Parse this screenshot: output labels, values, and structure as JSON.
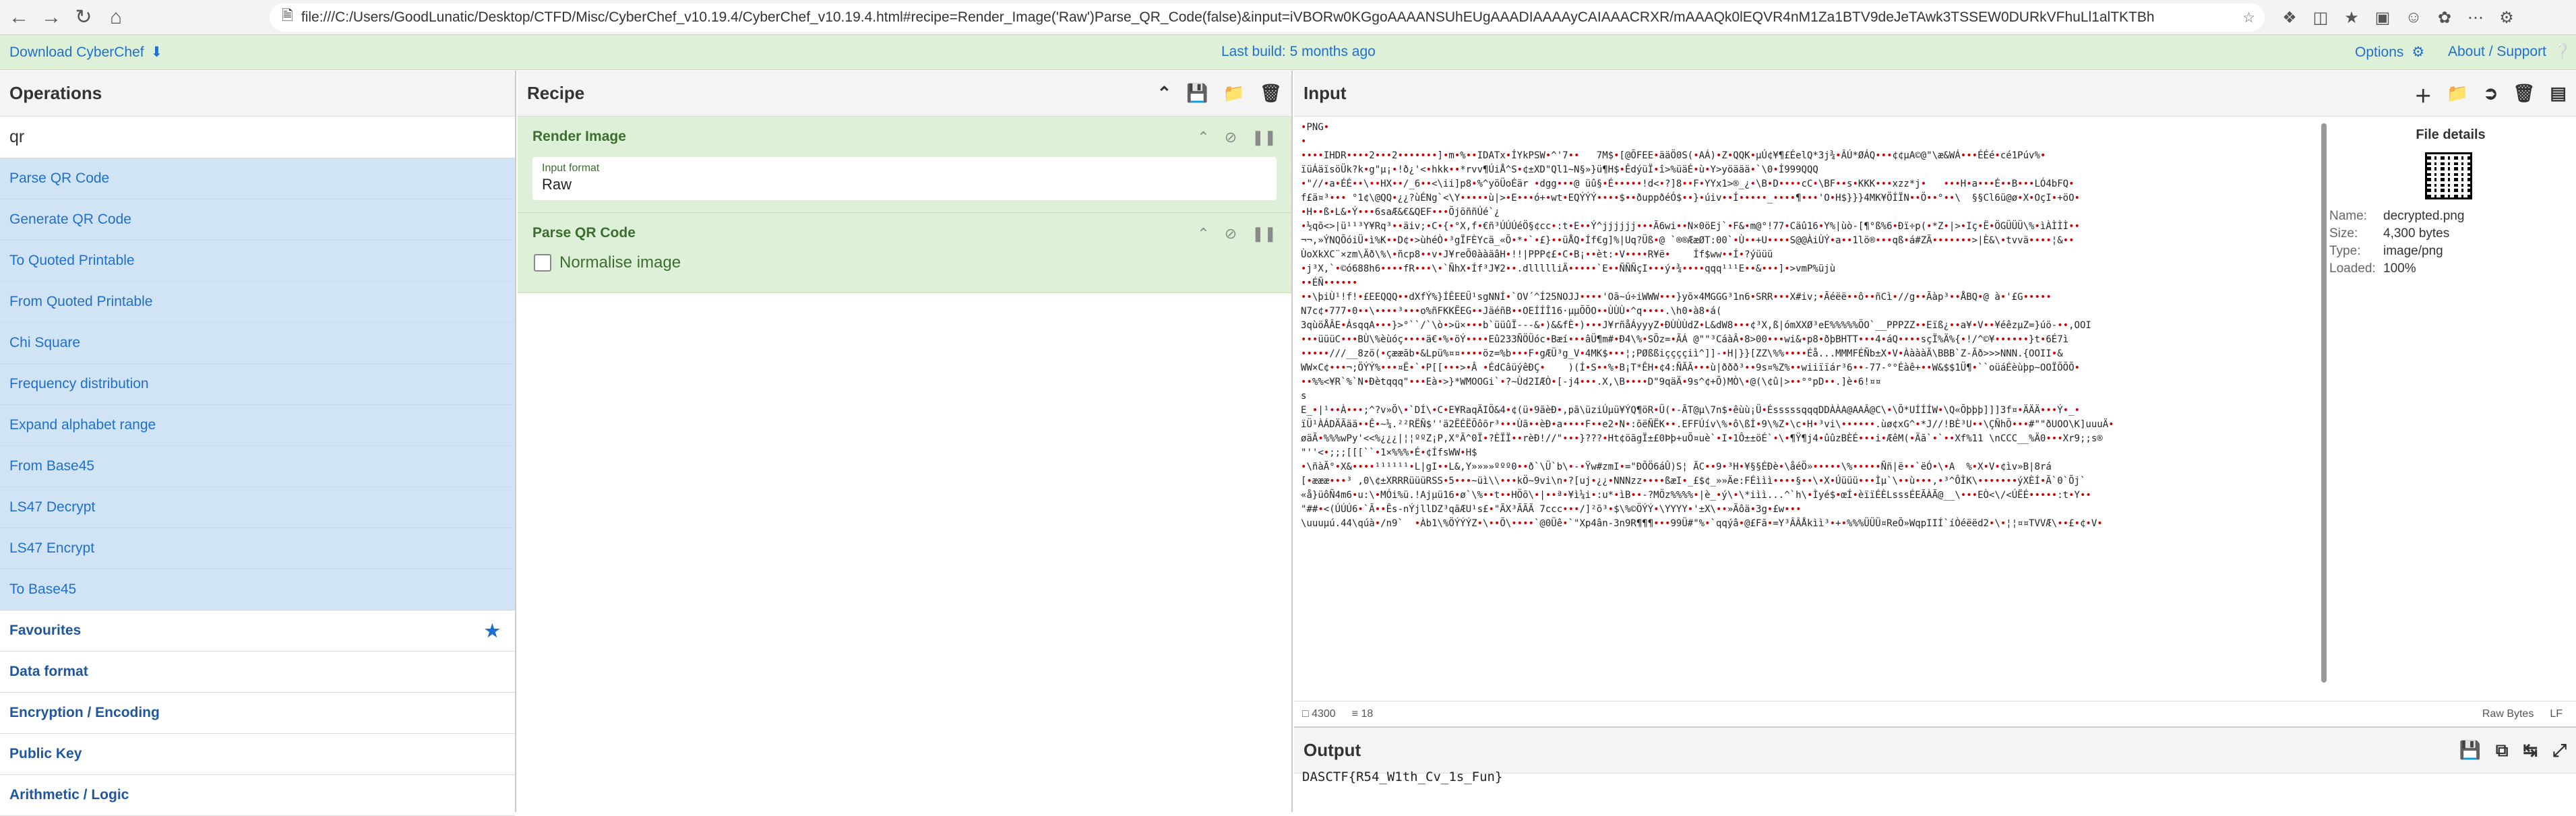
{
  "browser": {
    "url_prefix": "file:///",
    "url": "C:/Users/GoodLunatic/Desktop/CTFD/Misc/CyberChef_v10.19.4/CyberChef_v10.19.4.html#recipe=Render_Image('Raw')Parse_QR_Code(false)&input=iVBORw0KGgoAAAANSUhEUgAAADIAAAAyCAIAAACRXR/mAAAQk0lEQVR4nM1Za1BTV9deJeTAwk3TSSEW0DURkVFhuLl1alTKTBh"
  },
  "banner": {
    "download_label": "Download CyberChef",
    "build_label": "Last build: 5 months ago",
    "options_label": "Options",
    "about_label": "About / Support"
  },
  "operations": {
    "title": "Operations",
    "search_value": "qr",
    "results": [
      "Parse QR Code",
      "Generate QR Code",
      "To Quoted Printable",
      "From Quoted Printable",
      "Chi Square",
      "Frequency distribution",
      "Expand alphabet range",
      "From Base45",
      "LS47 Decrypt",
      "LS47 Encrypt",
      "To Base45"
    ],
    "categories": [
      "Favourites",
      "Data format",
      "Encryption / Encoding",
      "Public Key",
      "Arithmetic / Logic"
    ]
  },
  "recipe": {
    "title": "Recipe",
    "ops": [
      {
        "name": "Render Image",
        "field_label": "Input format",
        "field_value": "Raw"
      },
      {
        "name": "Parse QR Code",
        "checkbox_label": "Normalise image"
      }
    ]
  },
  "input": {
    "title": "Input",
    "status_chars": "4300",
    "status_lines": "18",
    "raw_bytes_label": "Raw Bytes",
    "eol_label": "LF",
    "raw_lines": [
      "•PNG•",
      "•",
      "••••IHDR••••2•••2•••••••]•m•%••IDATx•ÍYkPSW•^'7••   7M$•[@ÕFEE•ääÖ0S(•AÁ)•Z•QQK•µÚ¢¥¶£ÉelQ*3j¾•ÂÚ*ØÁQ•••¢¢µA©@\"\\æ&WÁ•••ÉÉé•cé1Púv%•",
      "ïüÁäïsöÜk?k•g\"µ¡•!ð¿'<•hkk••*rvv¶ÚiÅ^S•¢±XD\"Ql1~N§»}ü¶H$•ÊdýüÏ•î>%üäÉ•ù•Y>yöäää•`\\0•Í999QQQ",
      "•\"//•a•ÉÉ••\\••HX••/_6••<\\ii]p8•%^yöÜoÉär •dgg•••@ üû§•É•••••!d<•?]8••F•YYx1>®_¿•\\B•D••••cC•\\BF••s•KKK•••xzz*j•   •••H•a•••É••B•••LÓ4bFQ•",
      "f£ä¤³••• °1¢\\@QQ•¿¿?ùÉNg`<\\Y•••••ù|>•E•••ó+•wt•EQÝÝÝ••••$••ðuppðéÓ$••}•úiv••Í•••••_••••¶•••'O•H$}}}4MK¥ÖÍÏN••Ö••°••\\  §§Cl6ü@ø•X•OçI•+öO•",
      "•H••ß•L&•Ý•••6saÆ&€&QEF•••ÕjõññÚé`¿",
      "•½qõ<>|ü¹¹³Y¥Rq³••äiv;•C•{•°X,f•€ñ³ÚÚÚéÖ§¢cc•:t•E••Ý^jjjjjj•••Ã6wi••N×0öEj`•F&•m@°!77•Cäû16•Y%|ùò-[¶°ß%6•Ðï÷p(•*Z•|>•Iç•Ë•ÖGÜÜÜ\\%•ìÀÌÌÌ••",
      "¬¬,»ÝNQÕóiÜ•ì%K••D¢•>ùhéÒ•³gÏFÈYcä_«Õ•*•`•£}••üÅQ•Íf€g]%|Uq?Üß•@ `®®ÆæØT:00`•Ù••+U••••S@@ÀiÙÝ•a••1lö®•••qß•á#ZÃ•••••••>|È&\\•tvvä••••¦&••",
      "ÙoXkXC¨×zm\\Äð\\%\\•ñcp8••v•J¥reÕ0ààäâH•!!|PPP¢£•C•B¡••èt:•V••••R¥ë•    Íf$ww••Í•?ýüüü",
      "•j³X,`•©ó688h6••••fR•••\\•`ÑhX•Íf³J¥2••.dllllliÄ•••••`E••ÑÑÑçI•••ý•¾••••qqq¹¹¹E••&•••]•>vmP%üjù",
      "••ÉÑ••••••",
      "••\\þiÙ¹!f!•£EEQQQ••dXfÝ%}ÍÊEEÜ¹sgNNÍ•`OV´^Í25NOJJ••••'Oã~ú÷iWWW•••}yõ×4MGGG³1n6•SRR•••X#iv;•Ãéëë••ô••ñCì•//g••Ãàp³••ÅBQ•@ à•'£G•••••",
      "N7c¢•777•0••\\••••³•••o%ñFKKËEG••JäéñB••OEÍÍÎ16·µµÕÕO••ÙÙÙ•^q••••.\\h0•à8•á(",
      "3qùöÅÂE•ÁsqqA•••}>°``/`\\ò•>ü×•••b`üüûÏ---&•)&&fÈ•)•••J¥rñåÁyyyZ•ÐÙÙÙdZ•L&dW8•••¢³X,ß|ómXXØ³eE%%%%%ÖO`__PPPZZ••Eïß¿••a¥•V••¥éêzµZ=}úö-••,OOI",
      "•••üüüC•••BÙ\\%èùóç••••ä€•%•öÝ••••Eû233ÑÖÜóc•Bæí•••âÜ¶m#•Ð4\\%•SÕz=•ÃÁ @\"\"³CáàÂ•8>00•••wi&•p8•ðþBHTT•••4•áQ••••sçÏ%Ä%{•!/^©¥••••••}t•6É7ì",
      "•••••///__8zö(•çææãb•&Lpü%¤¤••••öz=%b•••F•gÆÜ³g_V•4MK$•••¦;PØßßiççççiì^]]-•H|}}[ZZ\\%%••••Éå...MMMFÉÑb±X•V•ÀàààÄ\\BBB`Z-Ãð>>>NNN.{OOII•&   ",
      "WW×C¢•••¬;ÖÝÝ%•••¤Ë•`•P[[•••>•Â •ÉdCâüýêÐÇ•    )(Í•S••%•B¡T*ÊH•¢4:ÑÃÃ•••ù|ððð³••9s¤%Z%••wiiïïár³6••-77-°°Éàê+••W&$$1Ü¶•``oüáÉèùþp~OOÏÕÕÕ•",
      "••%%<¥R`%`N•Ðètqqq\"•••Eà•>}*WMOOGi`•?~Ùd2IÆÒ•[-j4•••.X,\\B••••D\"9qäÄ•9s^¢+Õ)MÒ\\•@(\\¢û|>••°°pD••.]è•6!¤¤",
      "s",
      "E_•|¹••À•••;^?v»Õ\\•`DÍ\\•C•E¥RaqÄIÖ&4•¢(ü•9ãèÐ•,pã\\üziÚµü¥ÝQ¶öR•Ü(•-ÃT@µ\\7n$•êùù¡Ü•ÉsssssqqqDDÀÀA@AAÂ@C\\•\\Õ*UÍÍÍW•\\Q«Õþþþ]]]3f¤•ÄÄÄ•••Ý•_•",
      "ïÜ¹ÀÁDÄÃää••Ê•~¼.²²RËÑ$''ä2ËÉËÕôõr³•••Ùã••èÐ•a••••F••e2•N•:õëÑËK••.EFFÚív\\%•ô\\ßÍ•9\\%Z•\\c•H•³vi\\••••••.ùø¢xG^•*J//!BÈ³U••\\ÇÑhÕ•••#\"\"ðUOO\\K]uuuÄ•",
      "øäÃ•%%%wPy'<<%¿¿¿|¦¦ººZ¡P,X°Ã^0Ï•?ÈÏÏ••rèÐ!//\"•••}???•Ht¢öãgÏ±£0Þþ+uÕ¤uè`•I•1Ô±±öÉ`•\\•¶Ÿ¶j4•ûûzBÈÉ•••i•ÆêM(•Äã`•`••Xf%11 \\nCCC__%Ä0•••Xr9;;s®",
      "\"''<•;;;[[[``•1×%%%•É•¢ÍfsWW•H$",
      "•\\ñàÃ°•X&••••¹¹¹¹¹¹•L|gI••L&,Y»»»»ººº0••ð`\\Ü`b\\•-•Ÿw#zmI•=\"ÐÕÖ6áÛ)S¦ ÃC••9•³H•¥§§ÉÐè•\\åéÖ»•••••\\%•••••Ññ|ë••`ëÓ•\\•A  %•X•V•¢ìv»B|8rá",
      "[•æææ•••³ ,0\\¢±XRRRüüüRSS•5•••~üì\\\\•••kÖ~9vi\\n•?[uj•¿¿•NNNzz••••ßæI•_£$¢_»»Äe:FÉììì••••§••\\•X•Úüüü•••Ìµ`\\••ù•••,•³^ÔÌK\\•••••••ýXÈÍ•Ã`0`Õj`",
      "«å}üôÑ4m6•u:\\•MÓi%ü.!Ajµü16•ø`\\%••t••HÖõ\\•|••ª•¥ì¼i•:u*•ìB••-?MÖz%%%%•|è_•ý\\•\\*iìì...^`h\\•Ìyé$•œÍ•èïïÉÈLsssÉEÃÀÃ@__\\•••EÒ<\\/<ÚËÉ•••••:t•Y••",
      "\"##•<(ÚÚÚ6•`Ã••Ês-nÝjllDZ³qãÆU¹s£•\"ÃX³ÃÃÃ 7ccc•••/]²õ³•$\\%©ÖÝÝ•\\YYYY•'±X\\••»Ãôä•3g•£w•••",
      "\\uuuµú.44\\qúà•/n9`  •Àb1\\%ÖÝÝÝZ•\\••Õ\\••••`@0Üê•`\"Xp4ân-3n9R¶¶¶•••99Ü#\"%•`qqýâ•@£Fã•=Y³ÂÂÅkìì³•+•%%%ÜÜÜ¤ReÕ»WqpIIÍ`íÒéëëd2•\\•¦¦¤¤TVVÆ\\••£•¢•V•"
    ],
    "file_details": {
      "title": "File details",
      "name_label": "Name:",
      "name_value": "decrypted.png",
      "size_label": "Size:",
      "size_value": "4,300 bytes",
      "type_label": "Type:",
      "type_value": "image/png",
      "loaded_label": "Loaded:",
      "loaded_value": "100%"
    }
  },
  "output": {
    "title": "Output",
    "text": "DASCTF{R54_W1th_Cv_1s_Fun}"
  }
}
